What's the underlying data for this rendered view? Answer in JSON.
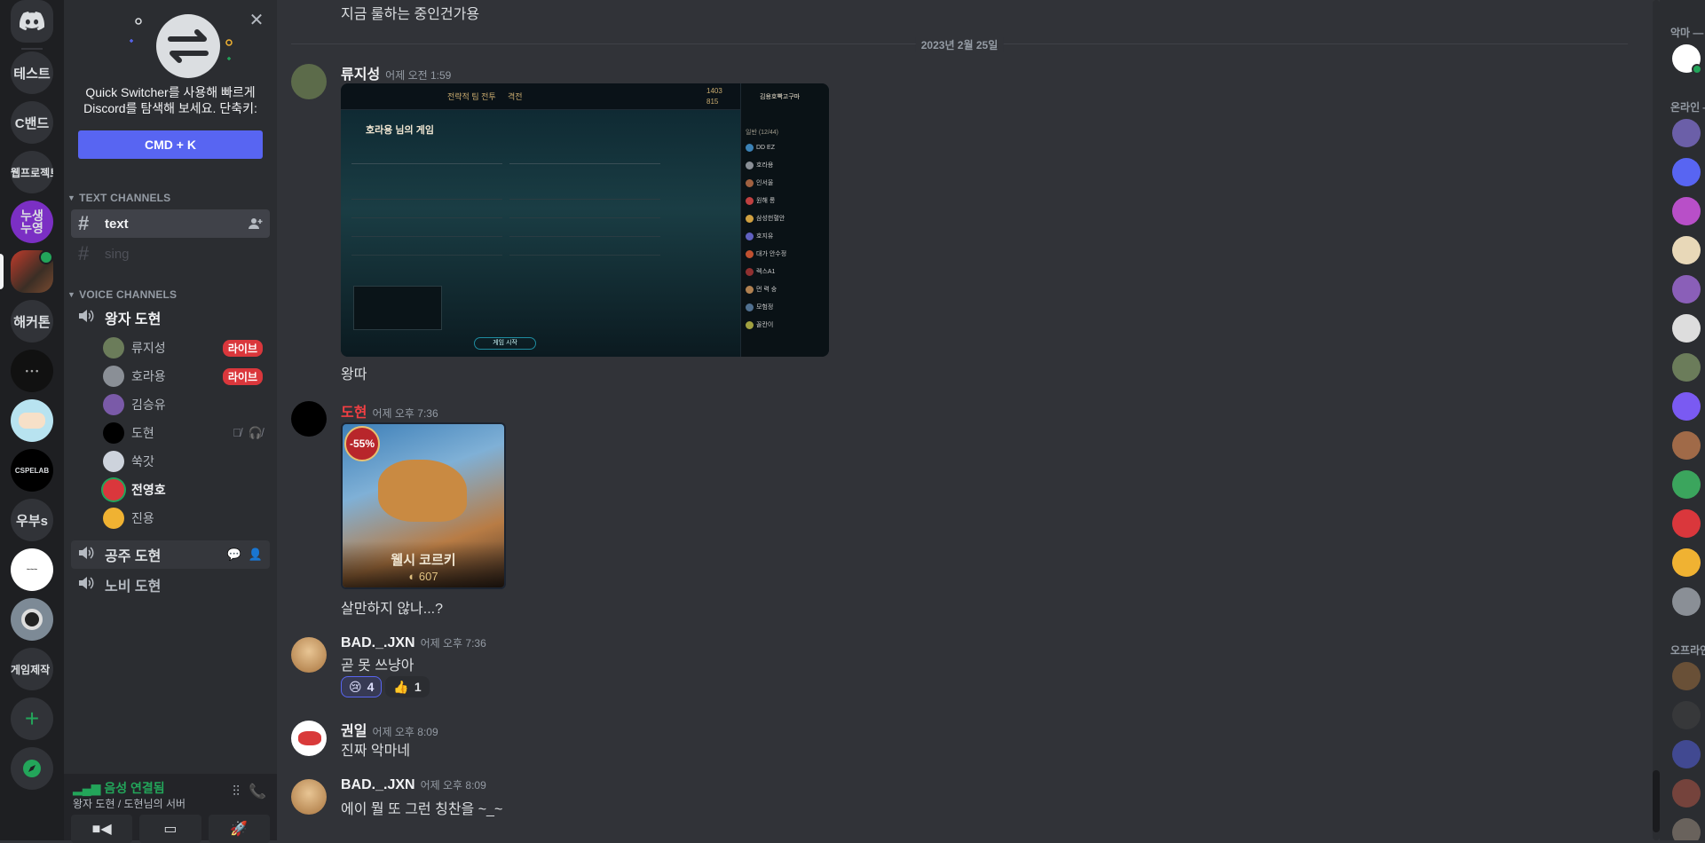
{
  "servers": [
    {
      "label": "",
      "name": "discord-home"
    },
    {
      "label": "테스트"
    },
    {
      "label": "C밴드"
    },
    {
      "label": "웹프로젝트"
    },
    {
      "label": "누생\n누영"
    },
    {
      "label": ""
    },
    {
      "label": "해커톤"
    },
    {
      "label": ""
    },
    {
      "label": ""
    },
    {
      "label": "CSPELAB"
    },
    {
      "label": "우부s"
    },
    {
      "label": ""
    },
    {
      "label": ""
    },
    {
      "label": "게임제작"
    }
  ],
  "quick_switcher": {
    "text": "Quick Switcher를 사용해 빠르게 Discord를 탐색해 보세요. 단축키:",
    "shortcut": "CMD + K"
  },
  "categories": {
    "text": "TEXT CHANNELS",
    "voice": "VOICE CHANNELS"
  },
  "text_channels": [
    {
      "name": "text",
      "active": true
    },
    {
      "name": "sing",
      "active": false
    }
  ],
  "voice_channels": {
    "vc1": "왕자 도현",
    "vc2": "공주 도현",
    "vc3": "노비 도현"
  },
  "voice_users": [
    {
      "name": "류지성",
      "live": "라이브",
      "color": "#6b7c5a"
    },
    {
      "name": "호라용",
      "live": "라이브",
      "color": "#8a8f96"
    },
    {
      "name": "김승유",
      "live": "",
      "color": "#7a5aa8"
    },
    {
      "name": "도현",
      "live": "",
      "color": "#000000"
    },
    {
      "name": "쑥갓",
      "live": "",
      "color": "#cdd3dc"
    },
    {
      "name": "전영호",
      "live": "",
      "color": "#da373c"
    },
    {
      "name": "진용",
      "live": "",
      "color": "#f0b232"
    }
  ],
  "voice_panel": {
    "status": "음성 연결됨",
    "location": "왕자 도현 / 도현님의 서버"
  },
  "chat": {
    "top_text": "지금 룰하는 중인건가용",
    "date_divider": "2023년 2월 25일",
    "messages": [
      {
        "user": "류지성",
        "time": "어제 오전 1:59",
        "text": "왕따",
        "color": "#f2f3f5"
      },
      {
        "user": "도현",
        "time": "어제 오후 7:36",
        "text": "살만하지 않나...?",
        "color": "#f23f43"
      },
      {
        "user": "BAD._.JXN",
        "time": "어제 오후 7:36",
        "text": "곧 못 쓰냥아",
        "color": "#f2f3f5"
      },
      {
        "user": "권일",
        "time": "어제 오후 8:09",
        "text": "진짜 악마네",
        "color": "#f2f3f5"
      },
      {
        "user": "BAD._.JXN",
        "time": "어제 오후 8:09",
        "text": "에이 뭘 또 그런 칭찬을 ~_~",
        "color": "#f2f3f5"
      }
    ],
    "game_shot": {
      "rp": "1403",
      "be": "815",
      "nav1": "전략적 팀 전투",
      "nav2": "격전",
      "lobby_title": "호라용 님의 게임",
      "start_btn": "게임 시작",
      "player": "김용호빡고구마",
      "friends_header": "일반 (12/44)",
      "friends": [
        "DD EZ",
        "호라용",
        "인서울",
        "원해 롱",
        "삼성헌혈안",
        "호지유",
        "대가 안수정",
        "렉스A1",
        "먼 력 숭",
        "모험정",
        "꼴칸이"
      ]
    },
    "card": {
      "discount": "-55%",
      "title": "웰시 코르키",
      "price": "607"
    },
    "reactions": [
      {
        "emoji": "😢",
        "count": "4",
        "me": true
      },
      {
        "emoji": "👍",
        "count": "1",
        "me": false
      }
    ]
  },
  "members": {
    "online_header_1": "악마 —",
    "online_header_2": "온라인 —",
    "offline_header": "오프라인 —"
  }
}
